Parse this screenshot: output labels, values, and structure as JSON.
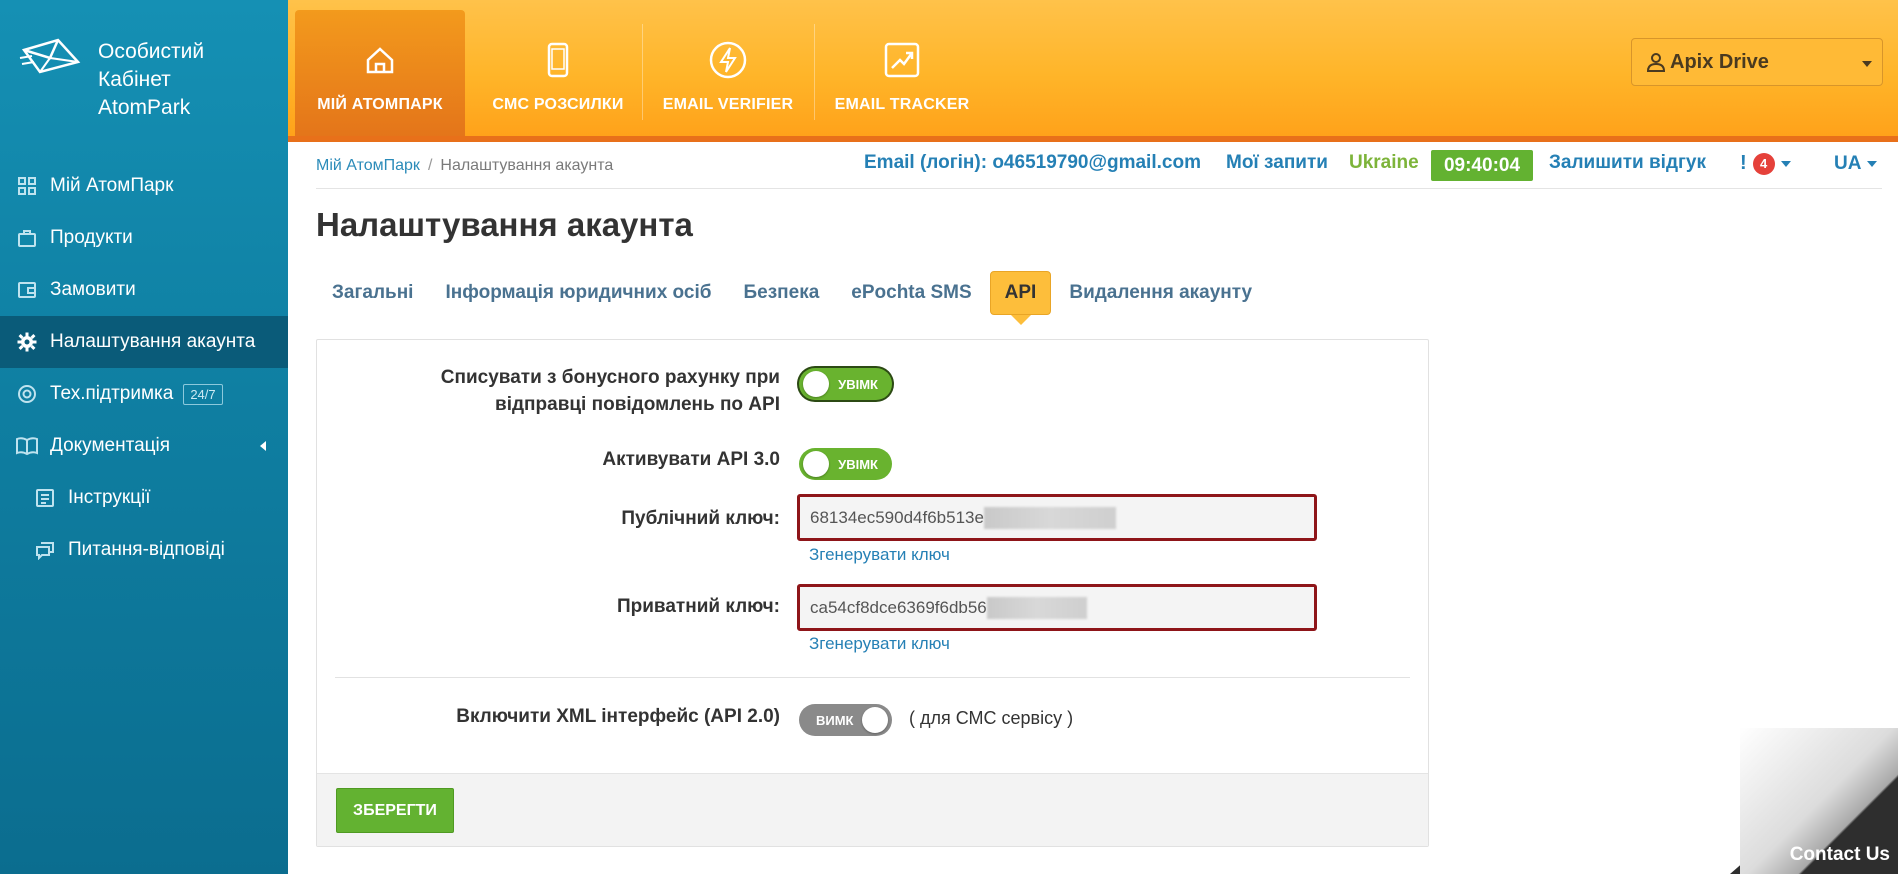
{
  "sidebar": {
    "logo_lines": [
      "Особистий",
      "Кабінет",
      "AtomPark"
    ],
    "items": [
      {
        "label": "Мій АтомПарк",
        "icon": "grid-icon"
      },
      {
        "label": "Продукти",
        "icon": "bag-icon"
      },
      {
        "label": "Замовити",
        "icon": "wallet-icon"
      },
      {
        "label": "Налаштування акаунта",
        "icon": "gear-icon",
        "active": true
      },
      {
        "label": "Тех.підтримка",
        "icon": "lifebuoy-icon",
        "badge": "24/7"
      },
      {
        "label": "Документація",
        "icon": "book-icon"
      },
      {
        "label": "Інструкції",
        "icon": "list-icon"
      },
      {
        "label": "Питання-відповіді",
        "icon": "chat-icon"
      }
    ]
  },
  "topnav": {
    "tabs": [
      {
        "label": "МІЙ АТОМПАРК",
        "icon": "home-icon",
        "active": true
      },
      {
        "label": "СМС РОЗСИЛКИ",
        "icon": "phone-icon"
      },
      {
        "label": "EMAIL VERIFIER",
        "icon": "bolt-icon"
      },
      {
        "label": "EMAIL TRACKER",
        "icon": "chart-up-icon"
      }
    ],
    "user": "Apix Drive"
  },
  "breadcrumb": {
    "home": "Мій АтомПарк",
    "sep": "/",
    "current": "Налаштування акаунта"
  },
  "infobar": {
    "email": "Email (логін): o46519790@gmail.com",
    "requests": "Мої запити",
    "country": "Ukraine",
    "time": "09:40:04",
    "feedback": "Залишити відгук",
    "notif_mark": "!",
    "notif_count": "4",
    "lang": "UA"
  },
  "page": {
    "title": "Налаштування акаунта",
    "tabs": [
      "Загальні",
      "Інформація юридичних осіб",
      "Безпека",
      "ePochta SMS",
      "API",
      "Видалення акаунту"
    ],
    "active_tab": "API"
  },
  "form": {
    "bonus_label_1": "Списувати з бонусного рахунку при",
    "bonus_label_2": "відправці повідомлень по API",
    "bonus_toggle": "УВІМК",
    "api3_label": "Активувати API 3.0",
    "api3_toggle": "УВІМК",
    "public_key_label": "Публічний ключ:",
    "public_key_value": "68134ec590d4f6b513e",
    "generate_link": "Згенерувати ключ",
    "private_key_label": "Приватний ключ:",
    "private_key_value": "ca54cf8dce6369f6db56",
    "xml_label": "Включити XML інтерфейс (API 2.0)",
    "xml_toggle": "ВИМК",
    "xml_note": "( для СМС сервісу )",
    "save": "ЗБЕРЕГТИ"
  },
  "contact": "Contact Us",
  "colors": {
    "accent_orange": "#ffb529",
    "sidebar_blue": "#1590b4",
    "green": "#63b231",
    "link_blue": "#2580b5",
    "key_border": "#8e1519"
  }
}
